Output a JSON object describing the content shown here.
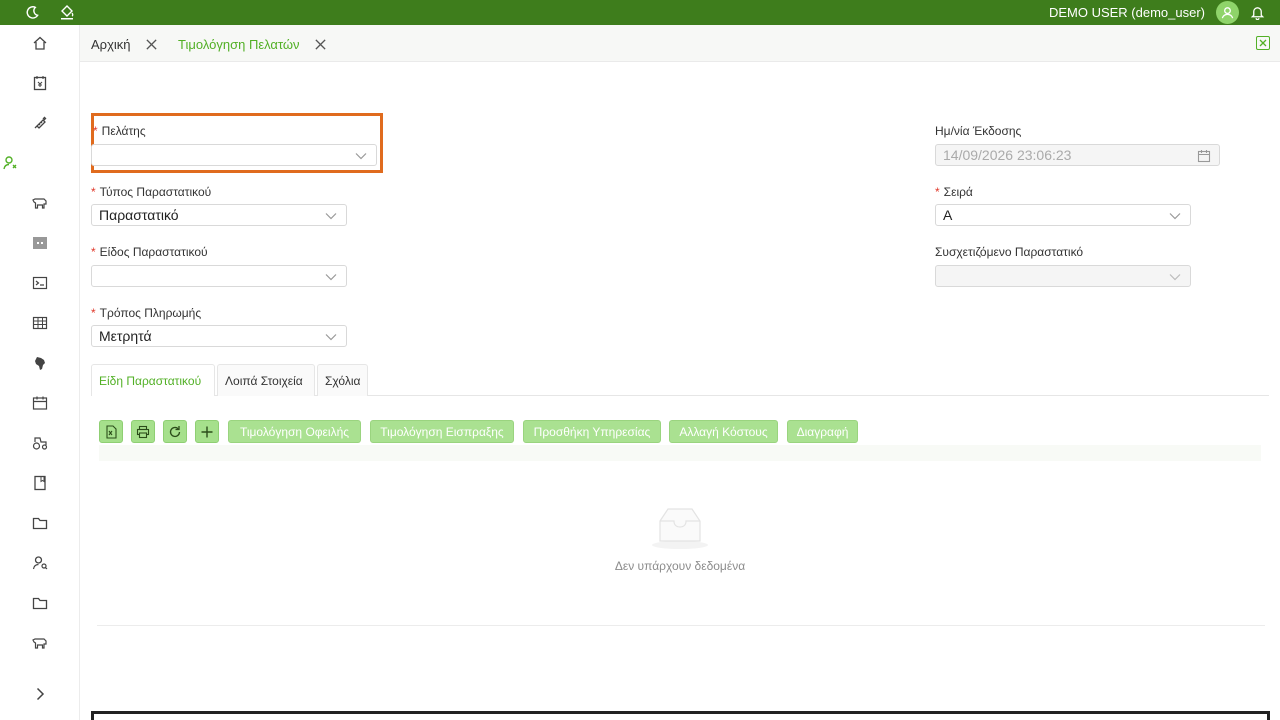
{
  "topbar": {
    "user_label": "DEMO USER (demo_user)",
    "bg_color": "#3e7d1c",
    "icons": [
      "moon-icon",
      "paint-bucket-icon",
      "user-avatar-icon",
      "bell-icon"
    ]
  },
  "sidebar": {
    "items": [
      {
        "name": "home-icon"
      },
      {
        "name": "invoice-yen-icon"
      },
      {
        "name": "syringe-icon"
      },
      {
        "name": "user-settings-icon",
        "active": true
      },
      {
        "name": "cow-icon"
      },
      {
        "name": "barcode-icon"
      },
      {
        "name": "terminal-icon"
      },
      {
        "name": "table-icon"
      },
      {
        "name": "africa-map-icon"
      },
      {
        "name": "calendar-icon"
      },
      {
        "name": "tractor-icon"
      },
      {
        "name": "book-icon"
      },
      {
        "name": "folder-icon"
      },
      {
        "name": "user-search-icon"
      },
      {
        "name": "folder-icon-2"
      },
      {
        "name": "cow-icon-2"
      },
      {
        "name": "expand-chevron-icon"
      }
    ]
  },
  "tabs": [
    {
      "label": "Αρχική",
      "active": false
    },
    {
      "label": "Τιμολόγηση Πελατών",
      "active": true
    }
  ],
  "form": {
    "customer_label": "Πελάτης",
    "customer_value": "",
    "doc_type_label": "Τύπος Παραστατικού",
    "doc_type_value": "Παραστατικό",
    "doc_kind_label": "Είδος Παραστατικού",
    "doc_kind_value": "",
    "payment_label": "Τρόπος Πληρωμής",
    "payment_value": "Μετρητά",
    "issue_date_label": "Ημ/νία Έκδοσης",
    "issue_date_value": "14/09/2026 23:06:23",
    "series_label": "Σειρά",
    "series_value": "A",
    "related_doc_label": "Συσχετιζόμενο Παραστατικό",
    "related_doc_value": "",
    "required_mark": "*"
  },
  "subtabs": [
    {
      "label": "Είδη Παραστατικού",
      "active": true
    },
    {
      "label": "Λοιπά Στοιχεία",
      "active": false
    },
    {
      "label": "Σχόλια",
      "active": false
    }
  ],
  "toolbar": {
    "buttons": [
      "Τιμολόγηση Οφειλής",
      "Τιμολόγηση Εισπραξης",
      "Προσθήκη Υπηρεσίας",
      "Αλλαγή Κόστους",
      "Διαγραφή"
    ],
    "accent": "#52b026"
  },
  "table": {
    "empty_text": "Δεν υπάρχουν δεδομένα"
  }
}
